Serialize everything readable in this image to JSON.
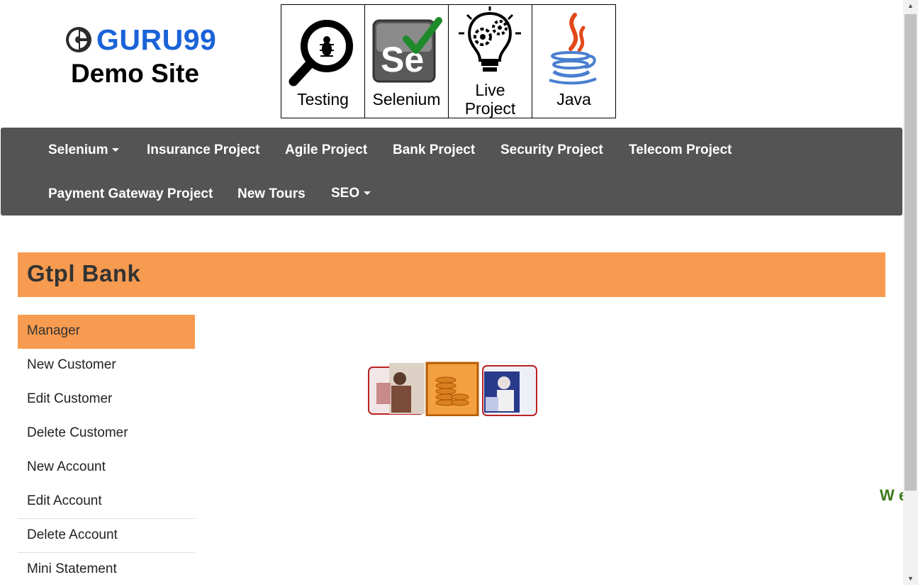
{
  "logo": {
    "brand": "GURU99",
    "subtitle": "Demo Site"
  },
  "top_links": [
    {
      "label": "Testing",
      "icon": "magnifier-bug-icon"
    },
    {
      "label": "Selenium",
      "icon": "selenium-logo-icon"
    },
    {
      "label": "Live Project",
      "icon": "lightbulb-gears-icon"
    },
    {
      "label": "Java",
      "icon": "java-cup-icon"
    }
  ],
  "navbar": {
    "row1": [
      "Selenium",
      "Insurance Project",
      "Agile Project",
      "Bank Project",
      "Security Project",
      "Telecom Project"
    ],
    "row2": [
      "Payment Gateway Project",
      "New Tours",
      "SEO"
    ]
  },
  "bank": {
    "title": "Gtpl Bank"
  },
  "menu": [
    "Manager",
    "New Customer",
    "Edit Customer",
    "Delete Customer",
    "New Account",
    "Edit Account",
    "Delete Account",
    "Mini Statement"
  ],
  "marquee": {
    "text": "W e"
  },
  "colors": {
    "accent": "#f79b50",
    "navbar": "#545454",
    "brand": "#1a63d8",
    "marquee": "#3c7a1a"
  }
}
